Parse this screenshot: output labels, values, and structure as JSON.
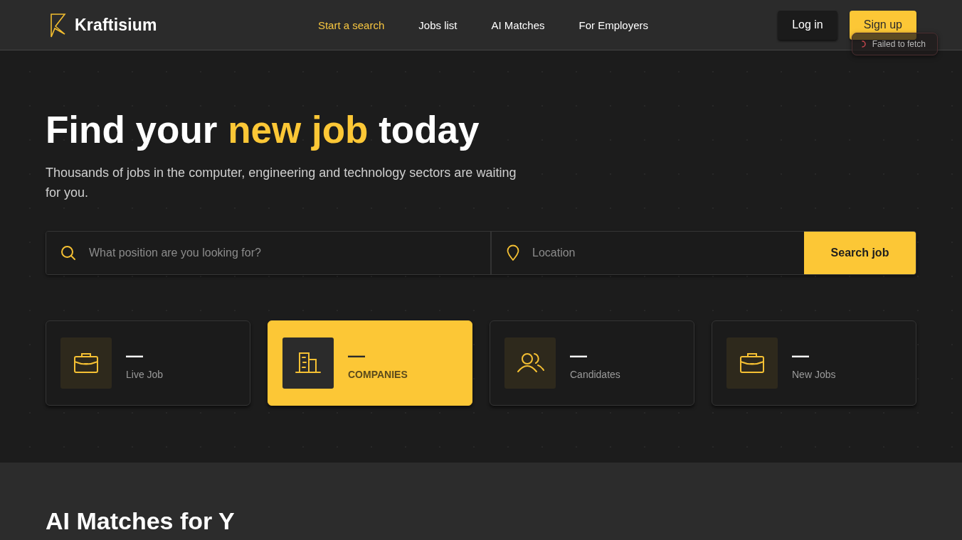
{
  "header": {
    "brand": "Kraftisium",
    "nav": [
      {
        "label": "Start a search",
        "selected": true
      },
      {
        "label": "Jobs list",
        "selected": false
      },
      {
        "label": "AI Matches",
        "selected": false
      },
      {
        "label": "For Employers",
        "selected": false
      }
    ],
    "actions": [
      {
        "label": "Log in",
        "kind": "secondary"
      },
      {
        "label": "Sign up",
        "kind": "primary"
      }
    ]
  },
  "toast": {
    "message": "Failed to fetch"
  },
  "hero": {
    "title": [
      {
        "text": "Find your ",
        "highlight": false
      },
      {
        "text": "new job",
        "highlight": true
      },
      {
        "text": " today",
        "highlight": false
      }
    ],
    "subtitle": "Thousands of jobs in the computer, engineering and technology sectors are waiting for you."
  },
  "search": {
    "position": {
      "placeholder": "What position are you looking for?"
    },
    "location": {
      "placeholder": "Location"
    },
    "button": "Search job"
  },
  "stats": [
    {
      "kind": "job",
      "value": "—",
      "label": "Live Job",
      "selected": false
    },
    {
      "kind": "company",
      "value": "—",
      "label": "COMPANIES",
      "selected": true
    },
    {
      "kind": "candidate",
      "value": "—",
      "label": "Candidates",
      "selected": false
    },
    {
      "kind": "job",
      "value": "—",
      "label": "New Jobs",
      "selected": false
    }
  ],
  "matches": {
    "title": "AI Matches for Y"
  }
}
